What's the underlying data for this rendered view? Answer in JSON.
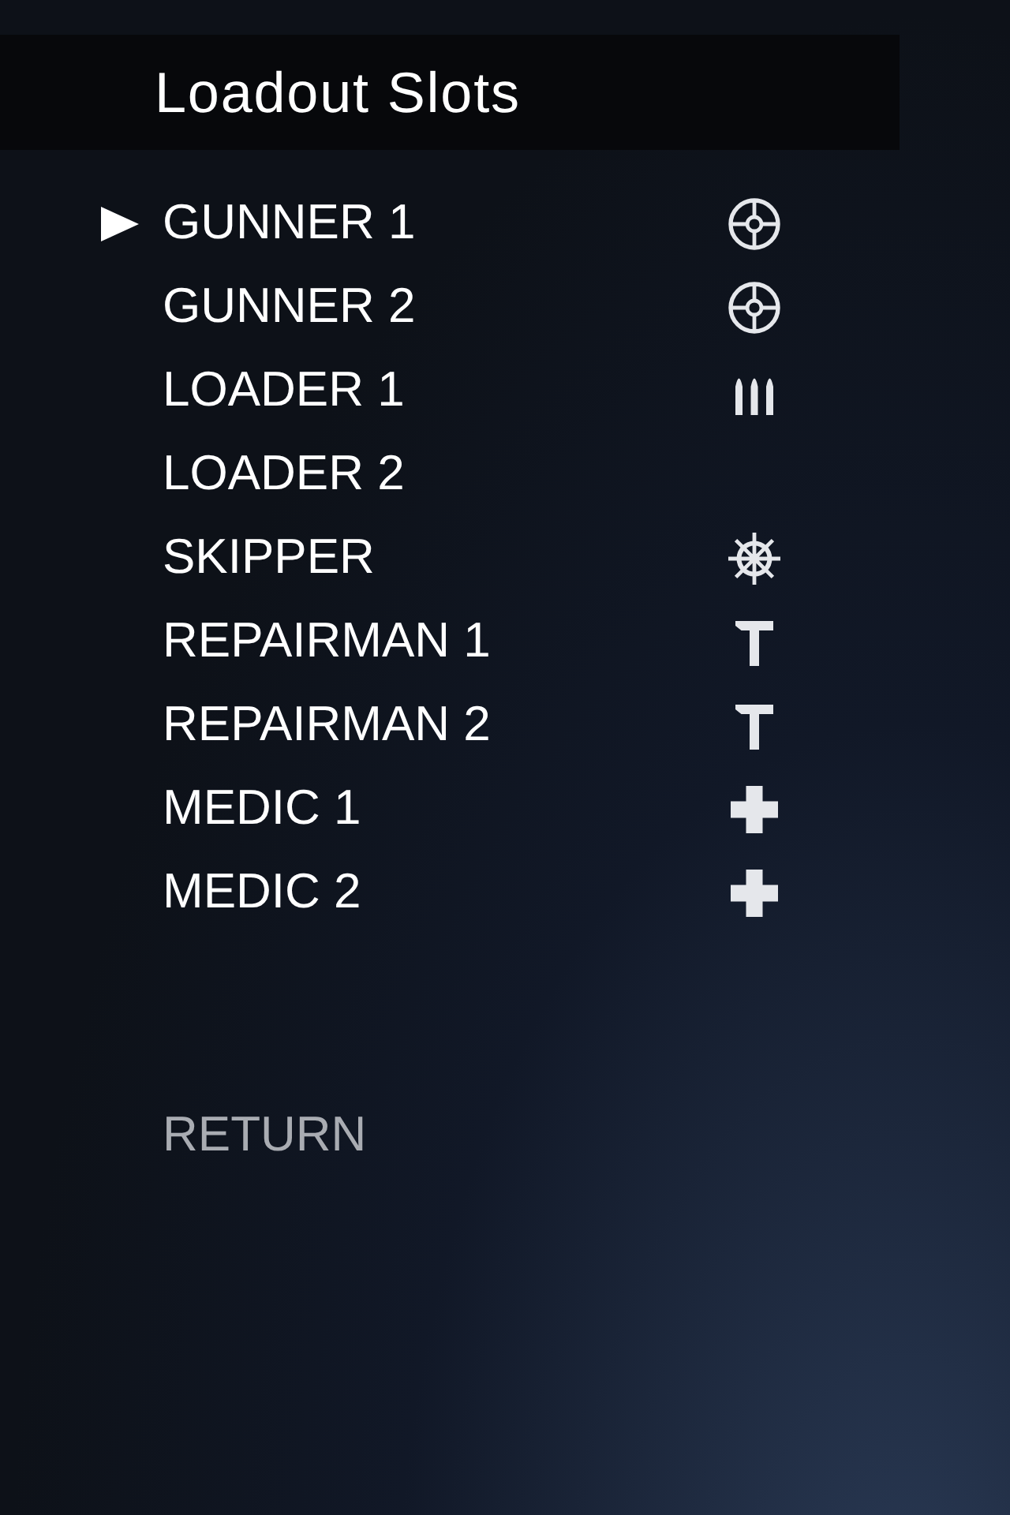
{
  "title": "Loadout Slots",
  "slots": [
    {
      "label": "GUNNER 1",
      "kind": "gunner",
      "icon_shown": true,
      "selected": true
    },
    {
      "label": "GUNNER 2",
      "kind": "gunner",
      "icon_shown": true,
      "selected": false
    },
    {
      "label": "LOADER 1",
      "kind": "loader",
      "icon_shown": true,
      "selected": false
    },
    {
      "label": "LOADER 2",
      "kind": "loader",
      "icon_shown": false,
      "selected": false
    },
    {
      "label": "SKIPPER",
      "kind": "skipper",
      "icon_shown": true,
      "selected": false
    },
    {
      "label": "REPAIRMAN 1",
      "kind": "repairman",
      "icon_shown": true,
      "selected": false
    },
    {
      "label": "REPAIRMAN 2",
      "kind": "repairman",
      "icon_shown": true,
      "selected": false
    },
    {
      "label": "MEDIC 1",
      "kind": "medic",
      "icon_shown": true,
      "selected": false
    },
    {
      "label": "MEDIC 2",
      "kind": "medic",
      "icon_shown": true,
      "selected": false
    }
  ],
  "return_label": "RETURN"
}
